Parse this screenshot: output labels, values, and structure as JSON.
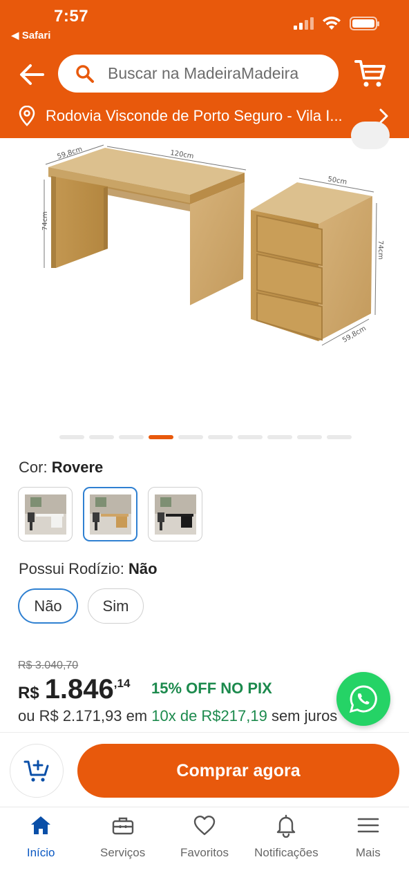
{
  "status_bar": {
    "time": "7:57",
    "back_app": "◀ Safari"
  },
  "header": {
    "search_placeholder": "Buscar na MadeiraMadeira",
    "address": "Rodovia Visconde de Porto Seguro - Vila I..."
  },
  "gallery": {
    "dimensions": {
      "desk_depth": "59,8cm",
      "desk_width": "120cm",
      "desk_height": "74cm",
      "drawer_width": "50cm",
      "drawer_height": "74cm",
      "drawer_depth": "59,8cm"
    },
    "page_count": 10,
    "active_index": 3
  },
  "color_option": {
    "label": "Cor:",
    "value": "Rovere",
    "swatches": [
      "Branco",
      "Rovere",
      "Preto"
    ],
    "selected_index": 1
  },
  "caster_option": {
    "label": "Possui Rodízio:",
    "value": "Não",
    "choices": [
      "Não",
      "Sim"
    ],
    "selected_index": 0
  },
  "pricing": {
    "old_price": "R$ 3.040,70",
    "currency": "R$",
    "price_int": "1.846",
    "price_cents": ",14",
    "pix_discount": "15% OFF NO PIX",
    "installments_prefix": "ou R$ 2.171,93 em ",
    "installments_highlight": "10x de R$217,19",
    "installments_suffix": " sem juros"
  },
  "actions": {
    "buy_label": "Comprar agora"
  },
  "tabs": [
    {
      "label": "Início",
      "icon": "home-icon",
      "active": true
    },
    {
      "label": "Serviços",
      "icon": "toolbox-icon",
      "active": false
    },
    {
      "label": "Favoritos",
      "icon": "heart-icon",
      "active": false
    },
    {
      "label": "Notificações",
      "icon": "bell-icon",
      "active": false
    },
    {
      "label": "Mais",
      "icon": "menu-icon",
      "active": false
    }
  ],
  "colors": {
    "brand": "#e8590c",
    "accent_blue": "#2f80d1",
    "pix_green": "#1c8a4d",
    "whatsapp": "#25d366",
    "tab_active": "#0a58c2"
  }
}
